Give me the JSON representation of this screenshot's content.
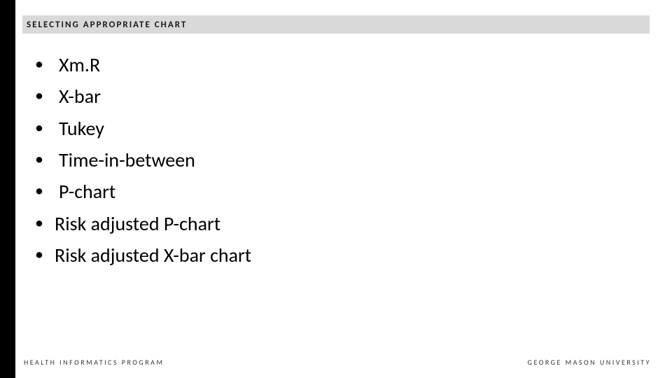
{
  "header": {
    "title": "SELECTING APPROPRIATE CHART"
  },
  "bullets": [
    {
      "text": "Xm.R",
      "indent": true
    },
    {
      "text": "X-bar",
      "indent": true
    },
    {
      "text": "Tukey",
      "indent": true
    },
    {
      "text": "Time-in-between",
      "indent": true
    },
    {
      "text": "P-chart",
      "indent": true
    },
    {
      "text": "Risk adjusted P-chart",
      "indent": false
    },
    {
      "text": "Risk adjusted X-bar chart",
      "indent": false
    }
  ],
  "footer": {
    "left": "HEALTH INFORMATICS PROGRAM",
    "right": "GEORGE MASON UNIVERSITY"
  }
}
